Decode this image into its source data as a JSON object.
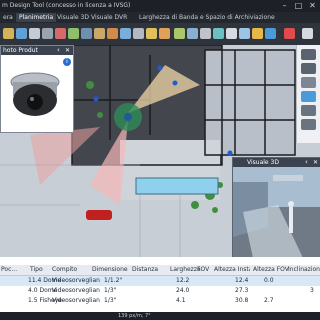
{
  "window": {
    "title": "m Design Tool (concesso in licenza a IVSG)",
    "controls": [
      "–",
      "□",
      "✕"
    ]
  },
  "tabs": [
    {
      "label": "era",
      "active": false
    },
    {
      "label": "Planimetria",
      "active": true
    },
    {
      "label": "Visuale 3D",
      "active": false
    },
    {
      "label": "Visuale DVR",
      "active": false
    },
    {
      "label": "Larghezza di Banda e Spazio di Archiviazione",
      "active": false
    }
  ],
  "photo_panel": {
    "title": "hoto Produt",
    "icons": [
      "chevron-left-icon",
      "close-icon",
      "info-icon"
    ]
  },
  "view3d_panel": {
    "title": "Visuale 3D",
    "icons": [
      "chevron-left-icon",
      "close-icon"
    ]
  },
  "table": {
    "columns": [
      "Poc...",
      "Tipo",
      "Compito",
      "Dimensione S...",
      "Distanza",
      "Larghezza",
      "FOV",
      "Altezza Installa...",
      "Altezza FOV",
      "Inclinazione"
    ],
    "rows": [
      {
        "poc": "",
        "tipo": "11.4 Dome",
        "compito": "Videosorveglian",
        "dim": "1/1.2\"",
        "dist": "",
        "larg": "12.2",
        "fov": "",
        "alt": "12.4",
        "altfov": "0.0",
        "incl": ""
      },
      {
        "poc": "",
        "tipo": "4.0 Dome",
        "compito": "Videosorveglian",
        "dim": "1/3\"",
        "dist": "",
        "larg": "24.0",
        "fov": "",
        "alt": "27.3",
        "altfov": "",
        "incl": "3"
      },
      {
        "poc": "",
        "tipo": "1.5 Fisheye",
        "compito": "Videosorveglian",
        "dim": "1/3\"",
        "dist": "",
        "larg": "4.1",
        "fov": "",
        "alt": "30.8",
        "altfov": "2.7",
        "incl": ""
      }
    ]
  },
  "status": {
    "text": "139 px/m, 7°"
  },
  "colors": {
    "accent": "#3a4250",
    "selection": "#d9e8f7"
  }
}
